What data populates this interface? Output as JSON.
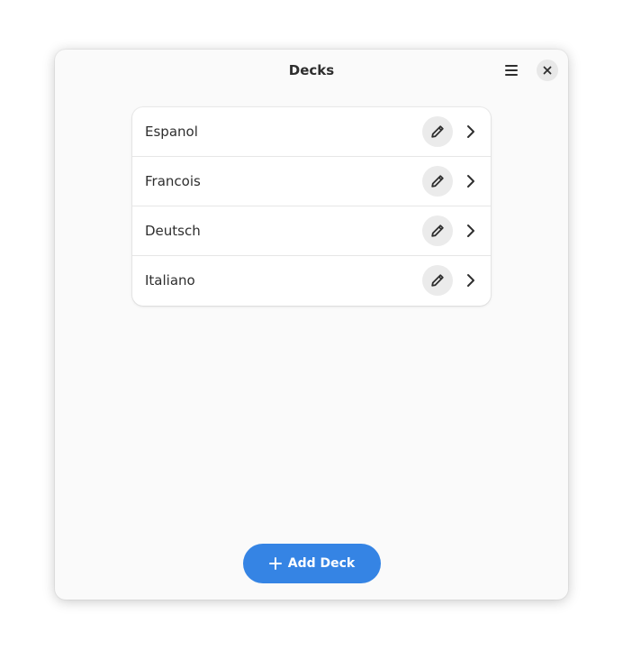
{
  "window": {
    "title": "Decks"
  },
  "header": {
    "menu_icon": "hamburger-menu-icon",
    "close_icon": "close-icon"
  },
  "decks": [
    {
      "label": "Espanol"
    },
    {
      "label": "Francois"
    },
    {
      "label": "Deutsch"
    },
    {
      "label": "Italiano"
    }
  ],
  "row_icons": {
    "edit": "pencil-icon",
    "open": "chevron-right-icon"
  },
  "footer": {
    "add_label": "Add Deck",
    "add_icon": "plus-icon"
  },
  "colors": {
    "accent": "#3584e4",
    "window_bg": "#fafafa",
    "card_bg": "#ffffff",
    "text": "#2e2e2e"
  }
}
